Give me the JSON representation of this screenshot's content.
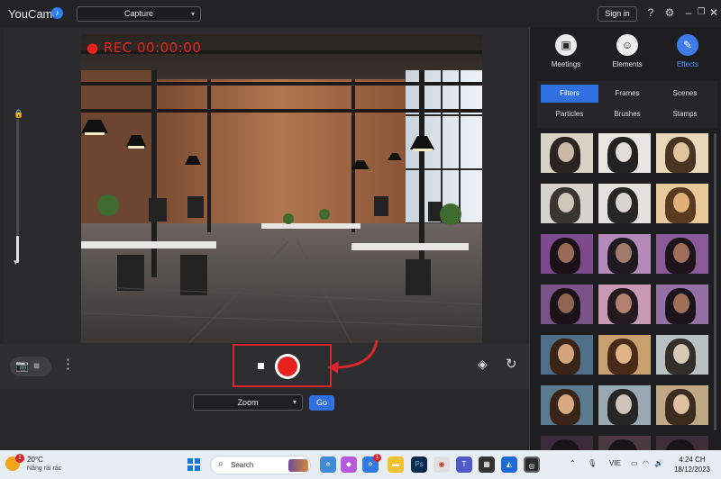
{
  "app": {
    "title": "YouCam",
    "notification_icon": "bell-icon",
    "mode": "Capture",
    "sign_in": "Sign in",
    "icons": [
      "help-icon",
      "gear-icon",
      "minimize-icon",
      "restore-icon",
      "close-icon"
    ]
  },
  "preview": {
    "rec_label": "● REC 00:00:00",
    "zoom_select": "Zoom",
    "go_label": "Go"
  },
  "sidebar": {
    "categories": [
      {
        "label": "Meetings",
        "icon": "meetings-icon"
      },
      {
        "label": "Elements",
        "icon": "smiley-icon"
      },
      {
        "label": "Effects",
        "icon": "magic-wand-icon",
        "active": true
      }
    ],
    "tabs": [
      "Filters",
      "Frames",
      "Scenes",
      "Particles",
      "Brushes",
      "Stamps"
    ],
    "active_tab": "Filters"
  },
  "taskbar": {
    "weather_temp": "20°C",
    "weather_desc": "Nắng rải rác",
    "weather_badge": "1",
    "search": "Search",
    "lang": "VIE",
    "time": "4:24 CH",
    "date": "18/12/2023",
    "edge_badge": "1"
  },
  "colors": {
    "accent": "#2f6fe0",
    "record": "#e8211f",
    "highlight_box": "#d9262c"
  }
}
